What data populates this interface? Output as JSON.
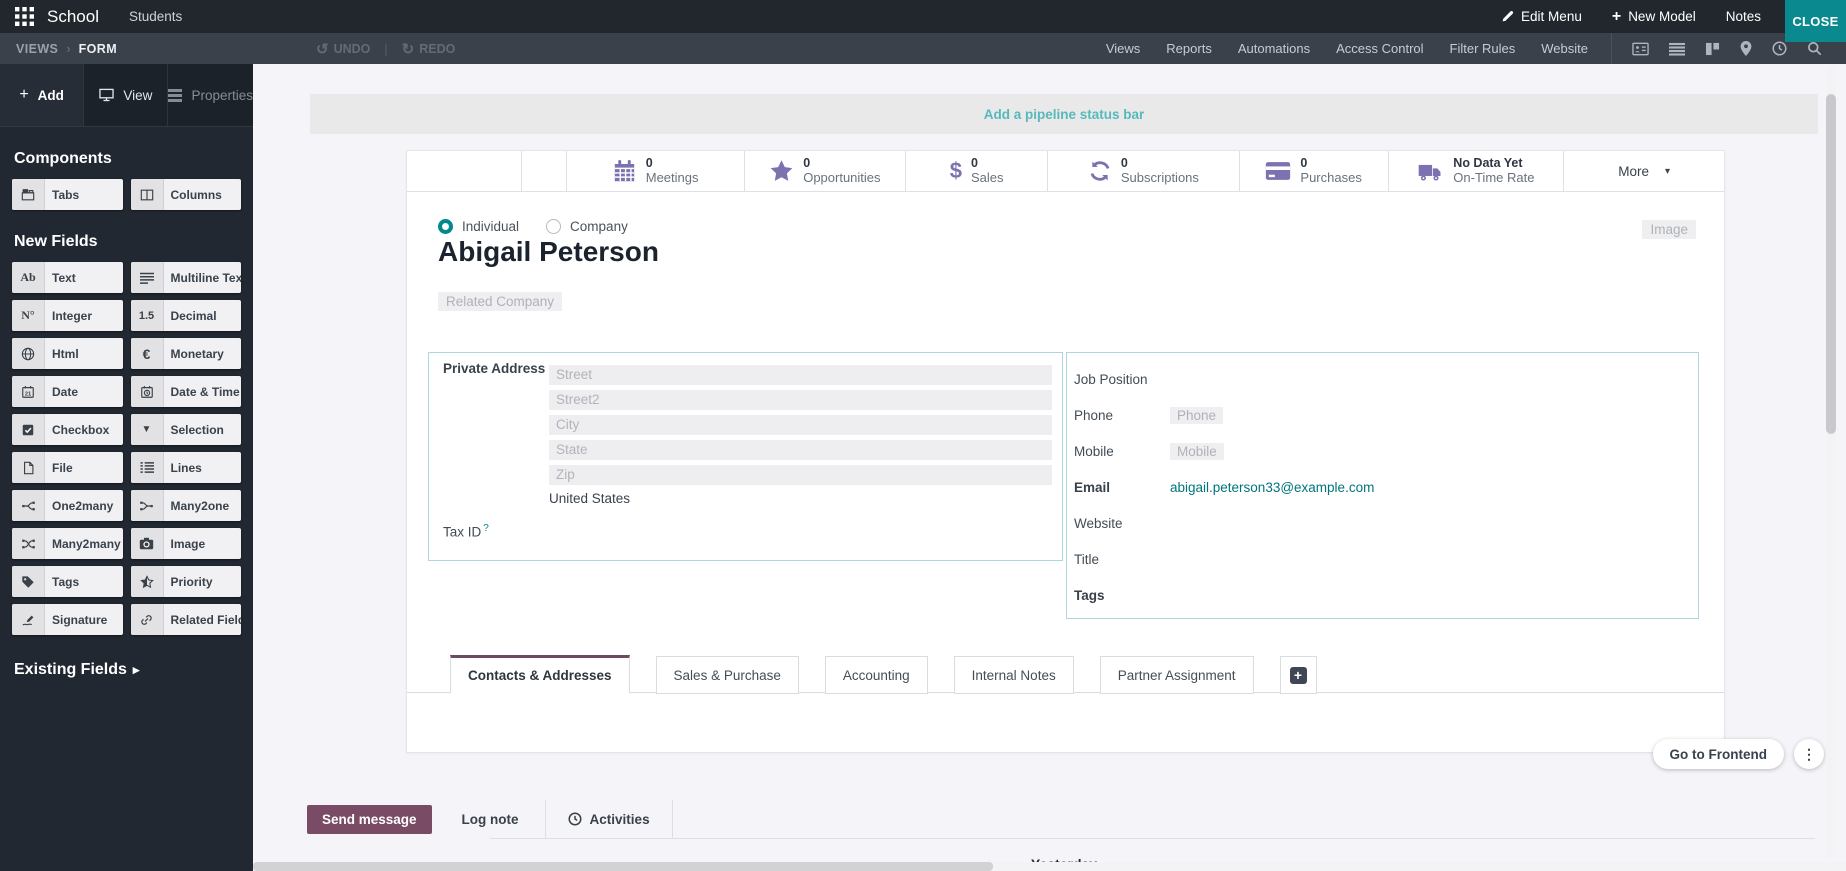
{
  "topbar": {
    "app_name": "School",
    "menu_item": "Students",
    "edit_menu": "Edit Menu",
    "new_model": "New Model",
    "notes": "Notes",
    "close": "CLOSE"
  },
  "toolbar": {
    "breadcrumb_root": "VIEWS",
    "breadcrumb_current": "FORM",
    "undo": "UNDO",
    "redo": "REDO",
    "menus": [
      {
        "label": "Views"
      },
      {
        "label": "Reports"
      },
      {
        "label": "Automations"
      },
      {
        "label": "Access Control"
      },
      {
        "label": "Filter Rules"
      },
      {
        "label": "Website"
      }
    ]
  },
  "sidebar": {
    "tabs": [
      {
        "label": "Add"
      },
      {
        "label": "View"
      },
      {
        "label": "Properties"
      }
    ],
    "components_title": "Components",
    "components": [
      {
        "label": "Tabs"
      },
      {
        "label": "Columns"
      }
    ],
    "new_fields_title": "New Fields",
    "fields": [
      {
        "label": "Text",
        "icon": "text"
      },
      {
        "label": "Multiline Text",
        "icon": "multiline"
      },
      {
        "label": "Integer",
        "icon": "integer"
      },
      {
        "label": "Decimal",
        "icon": "decimal"
      },
      {
        "label": "Html",
        "icon": "html"
      },
      {
        "label": "Monetary",
        "icon": "monetary"
      },
      {
        "label": "Date",
        "icon": "date"
      },
      {
        "label": "Date & Time",
        "icon": "datetime"
      },
      {
        "label": "Checkbox",
        "icon": "checkbox"
      },
      {
        "label": "Selection",
        "icon": "selection"
      },
      {
        "label": "File",
        "icon": "file"
      },
      {
        "label": "Lines",
        "icon": "lines"
      },
      {
        "label": "One2many",
        "icon": "one2many"
      },
      {
        "label": "Many2one",
        "icon": "many2one"
      },
      {
        "label": "Many2many",
        "icon": "many2many"
      },
      {
        "label": "Image",
        "icon": "camera"
      },
      {
        "label": "Tags",
        "icon": "tag"
      },
      {
        "label": "Priority",
        "icon": "star"
      },
      {
        "label": "Signature",
        "icon": "signature"
      },
      {
        "label": "Related Field",
        "icon": "link"
      }
    ],
    "existing_fields_title": "Existing Fields"
  },
  "banner": {
    "text": "Add a pipeline status bar"
  },
  "statbar": {
    "buttons": [
      {
        "count": "0",
        "label": "Meetings",
        "icon": "calendar"
      },
      {
        "count": "0",
        "label": "Opportunities",
        "icon": "star"
      },
      {
        "count": "0",
        "label": "Sales",
        "icon": "dollar"
      },
      {
        "count": "0",
        "label": "Subscriptions",
        "icon": "refresh"
      },
      {
        "count": "0",
        "label": "Purchases",
        "icon": "credit-card"
      }
    ],
    "ontime": {
      "value": "No Data Yet",
      "label": "On-Time Rate",
      "icon": "truck"
    },
    "more_label": "More"
  },
  "record": {
    "type_options": [
      {
        "label": "Individual",
        "selected": true
      },
      {
        "label": "Company",
        "selected": false
      }
    ],
    "name": "Abigail Peterson",
    "related_company_placeholder": "Related Company",
    "image_placeholder": "Image"
  },
  "address_group": {
    "label": "Private Address",
    "placeholders": [
      {
        "text": "Street"
      },
      {
        "text": "Street2"
      },
      {
        "text": "City"
      },
      {
        "text": "State"
      },
      {
        "text": "Zip"
      }
    ],
    "country": "United States",
    "tax_id_label": "Tax ID",
    "tax_id_help": "?"
  },
  "contact_group": {
    "rows": [
      {
        "label": "Job Position"
      },
      {
        "label": "Phone",
        "placeholder": "Phone"
      },
      {
        "label": "Mobile",
        "placeholder": "Mobile"
      },
      {
        "label": "Email",
        "value": "abigail.peterson33@example.com"
      },
      {
        "label": "Website"
      },
      {
        "label": "Title"
      },
      {
        "label": "Tags"
      }
    ]
  },
  "notebook": {
    "tabs": [
      {
        "label": "Contacts & Addresses",
        "active": true
      },
      {
        "label": "Sales & Purchase",
        "active": false
      },
      {
        "label": "Accounting",
        "active": false
      },
      {
        "label": "Internal Notes",
        "active": false
      },
      {
        "label": "Partner Assignment",
        "active": false
      }
    ]
  },
  "chatter": {
    "send_label": "Send message",
    "log_label": "Log note",
    "activities_label": "Activities",
    "frontend_label": "Go to Frontend",
    "day_divider": "Yesterday"
  },
  "icons": {
    "breadcrumb_sep": "›",
    "undo": "↺",
    "redo": "↻",
    "pipe": "|",
    "plus": "+",
    "caret_down": "▾",
    "caret_right": "▸",
    "kebab": "⋮",
    "text_glyph": "Ab",
    "integer_glyph": "N°",
    "decimal_glyph": "1.5",
    "monetary_glyph": "€",
    "selection_glyph": "▼",
    "dollar_glyph": "$"
  },
  "colors": {
    "accent_teal": "#0a8a8e",
    "brand_purple": "#714b67",
    "stat_icon_purple": "#7d72b0",
    "link_teal": "#01757c",
    "banner_text_teal": "#57b9ba"
  }
}
